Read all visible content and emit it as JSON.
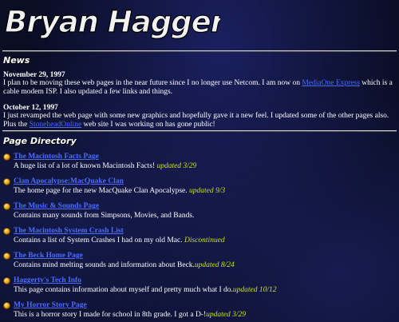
{
  "header": {
    "logo_text": "Bryan Haggerty's"
  },
  "news": {
    "title": "News",
    "items": [
      {
        "date": "November 29, 1997",
        "before": "I plan to be moving these web pages in the near future since I no longer use Netcom. I am now on ",
        "link": "MediaOne Express",
        "after": " which is a cable modem ISP. I also updated a few links and things."
      },
      {
        "date": "October 12, 1997",
        "before": "I just revamped the web page with some new graphics and hopefully gave it a new feel. I updated some of the other pages also. Plus the ",
        "link": "StoneheadOnline",
        "after": " web site I was working on has gone public!"
      }
    ]
  },
  "directory": {
    "title": "Page Directory",
    "entries": [
      {
        "link": "The Macintosh Facts Page",
        "desc": "A huge list of a lot of known Macintosh Facts! ",
        "updated": "updated 3/29"
      },
      {
        "link": "Clan Apocalypse:MacQuake Clan",
        "desc": "The home page for the new MacQuake Clan Apocalypse. ",
        "updated": "updated 9/3"
      },
      {
        "link": "The Music & Sounds Page",
        "desc": "Contains many sounds from Simpsons, Movies, and Bands.",
        "updated": ""
      },
      {
        "link": "The Macintosh System Crash List",
        "desc": "Contains a list of System Crashes I had on my old Mac. ",
        "updated": "Discontinued"
      },
      {
        "link": "The Beck Home Page",
        "desc": "Contains mind melting sounds and information about Beck.",
        "updated": "updated 8/24"
      },
      {
        "link": "Haggerty's Tech Info",
        "desc": "This page contains information about myself and pretty much what I do.",
        "updated": "updated 10/12"
      },
      {
        "link": "My Horror Story Page",
        "desc": "This is a horror story I made for school in 8th grade. I got a D-!",
        "updated": "updated 3/29"
      }
    ]
  },
  "colors": {
    "link": "#4a6cff",
    "updated": "#c8e020",
    "background": "#0a0d24"
  }
}
